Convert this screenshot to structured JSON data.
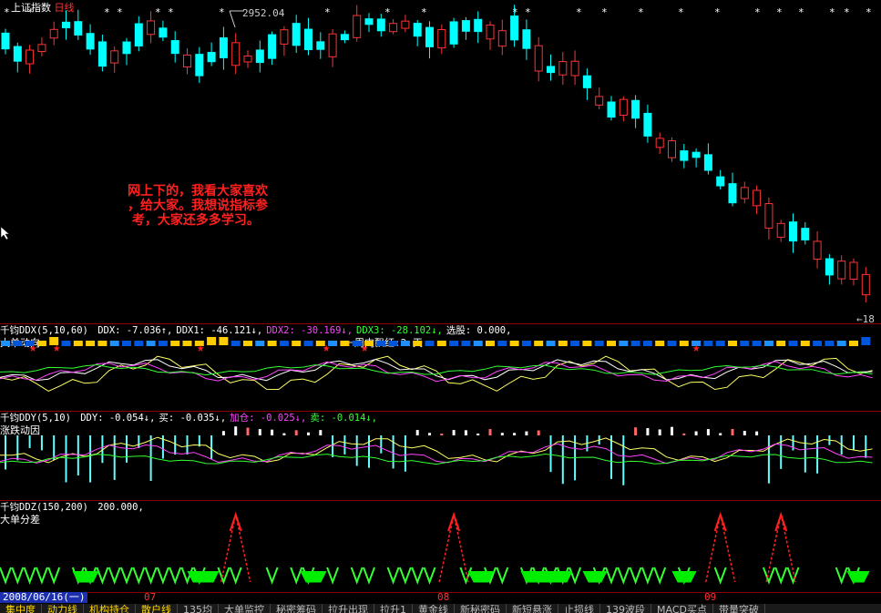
{
  "window": {
    "index_name": "上证指数",
    "period": "日线",
    "high_label": "2952.04",
    "low_label": "18"
  },
  "note_text": "网上下的，我看大家喜欢\n，给大家。我想说指标参\n 考，大家还多多学习。",
  "ddx_panel": {
    "title": "千钧DDX",
    "params": "(5,10,60)",
    "items": [
      {
        "label": "DDX: -7.036↑,",
        "color": "#ffffff"
      },
      {
        "label": "DDX1: -46.121↓,",
        "color": "#ffffff"
      },
      {
        "label": "DDX2: -30.169↓,",
        "color": "#ff44ff"
      },
      {
        "label": "DDX3: -28.102↓,",
        "color": "#33ff33"
      },
      {
        "label": "选股: 0.000,",
        "color": "#ffffff"
      }
    ],
    "subtitle": "大单动向",
    "annotation": "一周内飘红:2 天"
  },
  "ddy_panel": {
    "title": "千钧DDY",
    "params": "(5,10)",
    "items": [
      {
        "label": "DDY: -0.054↓,",
        "color": "#ffffff"
      },
      {
        "label": "买: -0.035↓,",
        "color": "#ffffff"
      },
      {
        "label": "加仓: -0.025↓,",
        "color": "#ff44ff"
      },
      {
        "label": "卖: -0.014↓,",
        "color": "#33ff33"
      }
    ],
    "subtitle": "涨跌动因"
  },
  "ddz_panel": {
    "title": "千钧DDZ",
    "params": "(150,200)",
    "value": "200.000,",
    "subtitle": "大单分差"
  },
  "date_bar": {
    "current_date": "2008/06/16(一)",
    "months": [
      "07",
      "08",
      "09"
    ]
  },
  "tabs": [
    {
      "label": "集中度",
      "hl": true
    },
    {
      "label": "动力线",
      "hl": true
    },
    {
      "label": "机构持仓",
      "hl": true
    },
    {
      "label": "散户线",
      "hl": true
    },
    {
      "label": "135均",
      "hl": false
    },
    {
      "label": "大单监控",
      "hl": false
    },
    {
      "label": "秘密筹码",
      "hl": false
    },
    {
      "label": "拉升出现",
      "hl": false
    },
    {
      "label": "拉升1",
      "hl": false
    },
    {
      "label": "黄金线",
      "hl": false
    },
    {
      "label": "新秘密码",
      "hl": false
    },
    {
      "label": "新短悬涨",
      "hl": false
    },
    {
      "label": "止损线",
      "hl": false
    },
    {
      "label": "139波段",
      "hl": false
    },
    {
      "label": "MACD买点",
      "hl": false
    },
    {
      "label": "带量突破",
      "hl": false
    }
  ],
  "colors": {
    "up": "#ff3333",
    "down": "#00ffff",
    "border": "#8b0000",
    "ma_white": "#ffffff",
    "ma_yellow": "#ffff66",
    "ma_magenta": "#ff44ff",
    "ma_green": "#33ff33"
  },
  "chart_data": {
    "type": "candlestick",
    "candles": [
      [
        0,
        0,
        1
      ],
      [
        1,
        0,
        0
      ],
      [
        1,
        0,
        0
      ],
      [
        0,
        1,
        0
      ],
      [
        0,
        1,
        1
      ],
      [
        1,
        1,
        0
      ],
      [
        0,
        1,
        0
      ],
      [
        1,
        0,
        0
      ],
      [
        1,
        0,
        1
      ],
      [
        0,
        1,
        0
      ],
      [
        1,
        0,
        1
      ],
      [
        1,
        0,
        1
      ],
      [
        0,
        1,
        0
      ],
      [
        0,
        1,
        1
      ],
      [
        1,
        0,
        0
      ],
      [
        0,
        1,
        0
      ],
      [
        1,
        1,
        0
      ],
      [
        1,
        0,
        0
      ],
      [
        0,
        1,
        0
      ],
      [
        1,
        0,
        0
      ]
    ]
  }
}
